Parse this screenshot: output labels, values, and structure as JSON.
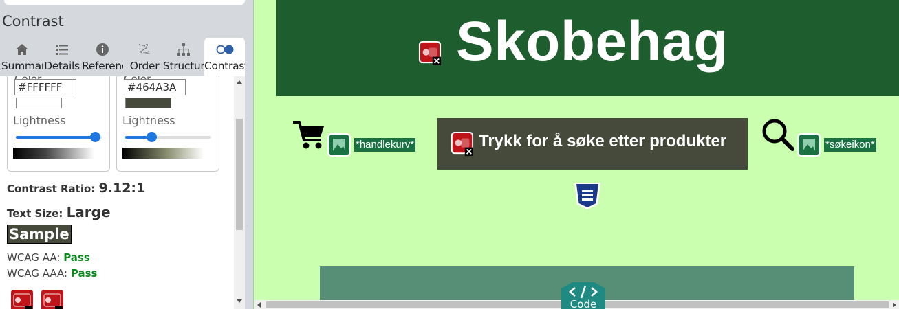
{
  "panel": {
    "heading": "Contrast",
    "tabs": [
      {
        "label": "Summary",
        "icon": "home-icon"
      },
      {
        "label": "Details",
        "icon": "list-icon"
      },
      {
        "label": "Reference",
        "icon": "info-icon"
      },
      {
        "label": "Order",
        "icon": "order-icon"
      },
      {
        "label": "Structure",
        "icon": "structure-icon"
      },
      {
        "label": "Contrast",
        "icon": "contrast-icon",
        "active": true
      }
    ],
    "foreground": {
      "label": "Color",
      "hex": "#FFFFFF",
      "lightness_label": "Lightness",
      "lightness": 0.92
    },
    "background": {
      "label": "Color",
      "hex": "#464A3A",
      "lightness_label": "Lightness",
      "lightness": 0.3
    },
    "contrast_ratio_label": "Contrast Ratio:",
    "contrast_ratio": "9.12:1",
    "text_size_label": "Text Size:",
    "text_size": "Large",
    "sample": "Sample",
    "wcag_aa_label": "WCAG AA:",
    "wcag_aa": "Pass",
    "wcag_aaa_label": "WCAG AAA:",
    "wcag_aaa": "Pass"
  },
  "preview": {
    "title": "Skobehag",
    "cart_alt": "*handlekurv*",
    "search_button": "Trykk for å søke etter produkter",
    "search_alt": "*søkeikon*",
    "code_label": "Code"
  },
  "colors": {
    "page_bg": "#c9ffae",
    "banner": "#1e5d2e",
    "button_bg": "#464a3a",
    "alt_label_bg": "#1a7142",
    "content_block": "#568f76",
    "accent": "#1e77e0",
    "pass": "#0b8a1e",
    "error_red": "#c0141b"
  }
}
